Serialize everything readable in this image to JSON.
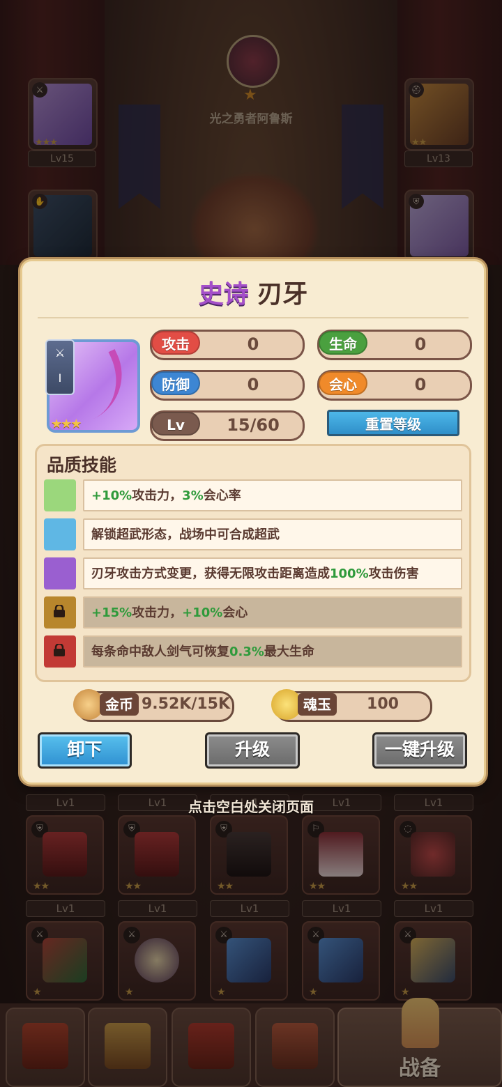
{
  "hero": {
    "name": "光之勇者阿鲁斯"
  },
  "equipped": {
    "left_top_level": "Lv15",
    "right_top_level": "Lv13"
  },
  "modal": {
    "rarity": "史诗",
    "item_name": "刃牙",
    "stats": {
      "attack": {
        "label": "攻击",
        "value": "0",
        "color": "#e24d45"
      },
      "hp": {
        "label": "生命",
        "value": "0",
        "color": "#4aa03f"
      },
      "defense": {
        "label": "防御",
        "value": "0",
        "color": "#3d86d3"
      },
      "crit": {
        "label": "会心",
        "value": "0",
        "color": "#f08a2a"
      },
      "level": {
        "label": "Lv",
        "value": "15/60"
      }
    },
    "reset_level_label": "重置等级",
    "skills_title": "品质技能",
    "skills": [
      {
        "pre": "",
        "hl1": "+10%",
        "mid": "攻击力，",
        "hl2": "3%",
        "post": "会心率",
        "color": "#9bd77c",
        "locked": false
      },
      {
        "text": "解锁超武形态，战场中可合成超武",
        "color": "#5fb7e4",
        "locked": false
      },
      {
        "pre": "刃牙攻击方式变更，获得无限攻击距离造成",
        "hl1": "100%",
        "post": "攻击伤害",
        "color": "#9a5fd0",
        "locked": false
      },
      {
        "hl1": "+15%",
        "mid": "攻击力，",
        "hl2": "+10%",
        "post": "会心",
        "color": "#b8862c",
        "locked": true
      },
      {
        "pre": "每条命中敌人剑气可恢复",
        "hl1": "0.3%",
        "post": "最大生命",
        "color": "#c23a35",
        "locked": true
      }
    ],
    "currency": {
      "gold": {
        "label": "金币",
        "value": "9.52K/15K"
      },
      "soul": {
        "label": "魂玉",
        "value": "100"
      }
    },
    "buttons": {
      "unequip": "卸下",
      "upgrade": "升级",
      "upgrade_all": "一键升级"
    }
  },
  "close_hint": "点击空白处关闭页面",
  "inventory": {
    "row1_levels": [
      "Lv1",
      "Lv1",
      "Lv1",
      "Lv1",
      "Lv1"
    ],
    "row2_levels": [
      "Lv1",
      "Lv1",
      "Lv1",
      "Lv1",
      "Lv1"
    ]
  },
  "nav": {
    "active_label": "战备"
  }
}
